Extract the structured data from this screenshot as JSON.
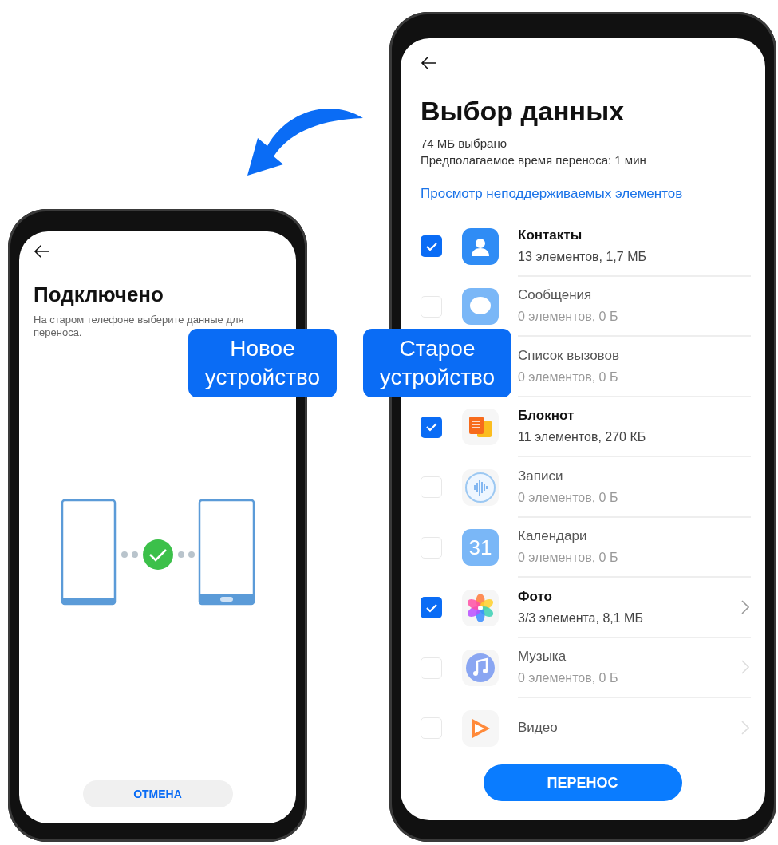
{
  "new_phone": {
    "title": "Подключено",
    "description": "На старом телефоне выберите данные для переноса.",
    "cancel_button": "ОТМЕНА"
  },
  "old_phone": {
    "title": "Выбор данных",
    "selected_size": "74 МБ выбрано",
    "estimated_time": "Предполагаемое время переноса: 1 мин",
    "unsupported_link": "Просмотр неподдерживаемых элементов",
    "items": [
      {
        "kind": "contacts",
        "name": "Контакты",
        "detail": "13 элементов, 1,7 МБ",
        "checked": true
      },
      {
        "kind": "messages",
        "name": "Сообщения",
        "detail": "0 элементов, 0 Б",
        "checked": false
      },
      {
        "kind": "calls",
        "name": "Список вызовов",
        "detail": "0 элементов, 0 Б"
      },
      {
        "kind": "notes",
        "name": "Блокнот",
        "detail": "11 элементов, 270 КБ",
        "checked": true
      },
      {
        "kind": "recorder",
        "name": "Записи",
        "detail": "0 элементов, 0 Б",
        "checked": false
      },
      {
        "kind": "calendar",
        "name": "Календари",
        "detail": "0 элементов, 0 Б",
        "checked": false,
        "icon_label": "31"
      },
      {
        "kind": "photos",
        "name": "Фото",
        "detail": "3/3 элемента, 8,1 МБ",
        "checked": true
      },
      {
        "kind": "music",
        "name": "Музыка",
        "detail": "0 элементов, 0 Б",
        "checked": false
      },
      {
        "kind": "video",
        "name": "Видео",
        "checked": false
      }
    ],
    "transfer_button": "ПЕРЕНОС"
  },
  "labels": {
    "new_device": "Новое устройство",
    "old_device": "Старое устройство"
  }
}
